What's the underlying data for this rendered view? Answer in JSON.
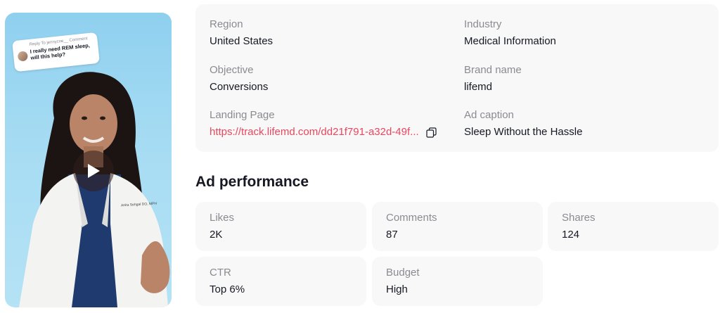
{
  "video": {
    "reply_meta": "Reply To jennycne__ Comment",
    "reply_text": "I really need REM sleep, will this help?",
    "coat_tag": "Anita Sehgal DO, MPH"
  },
  "info": {
    "region": {
      "label": "Region",
      "value": "United States"
    },
    "industry": {
      "label": "Industry",
      "value": "Medical Information"
    },
    "objective": {
      "label": "Objective",
      "value": "Conversions"
    },
    "brand": {
      "label": "Brand name",
      "value": "lifemd"
    },
    "landing": {
      "label": "Landing Page",
      "value": "https://track.lifemd.com/dd21f791-a32d-49f..."
    },
    "caption": {
      "label": "Ad caption",
      "value": "Sleep Without the Hassle"
    }
  },
  "performance": {
    "title": "Ad performance",
    "likes": {
      "label": "Likes",
      "value": "2K"
    },
    "comments": {
      "label": "Comments",
      "value": "87"
    },
    "shares": {
      "label": "Shares",
      "value": "124"
    },
    "ctr": {
      "label": "CTR",
      "value": "Top 6%"
    },
    "budget": {
      "label": "Budget",
      "value": "High"
    }
  },
  "colors": {
    "link": "#e8475f",
    "card_bg": "#f8f8f8",
    "label": "#8a8b91",
    "text": "#161823"
  },
  "icons": [
    "play-icon",
    "copy-icon"
  ]
}
